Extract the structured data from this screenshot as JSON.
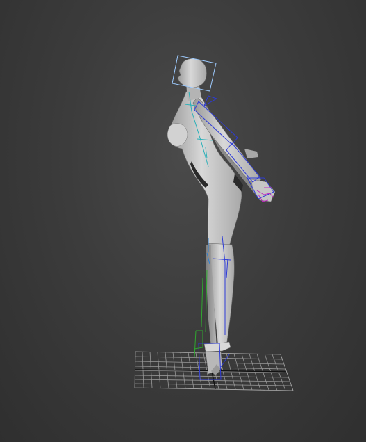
{
  "viewport": {
    "view": "perspective",
    "background_color": "#3c3c3c",
    "grid_color": "#9a9a9a",
    "model_color": "#c8c8c8",
    "bone_colors": {
      "spine": "#2a7fd6",
      "arms": "#2d3bd8",
      "left_leg": "#2fa82f",
      "hand": "#c02fc0",
      "head_box": "#9ecbff"
    },
    "objects": [
      {
        "name": "character-mesh",
        "icon": "human-figure-icon"
      },
      {
        "name": "biped-skeleton",
        "icon": "bone-icon"
      },
      {
        "name": "ground-grid",
        "icon": "grid-icon"
      }
    ]
  }
}
